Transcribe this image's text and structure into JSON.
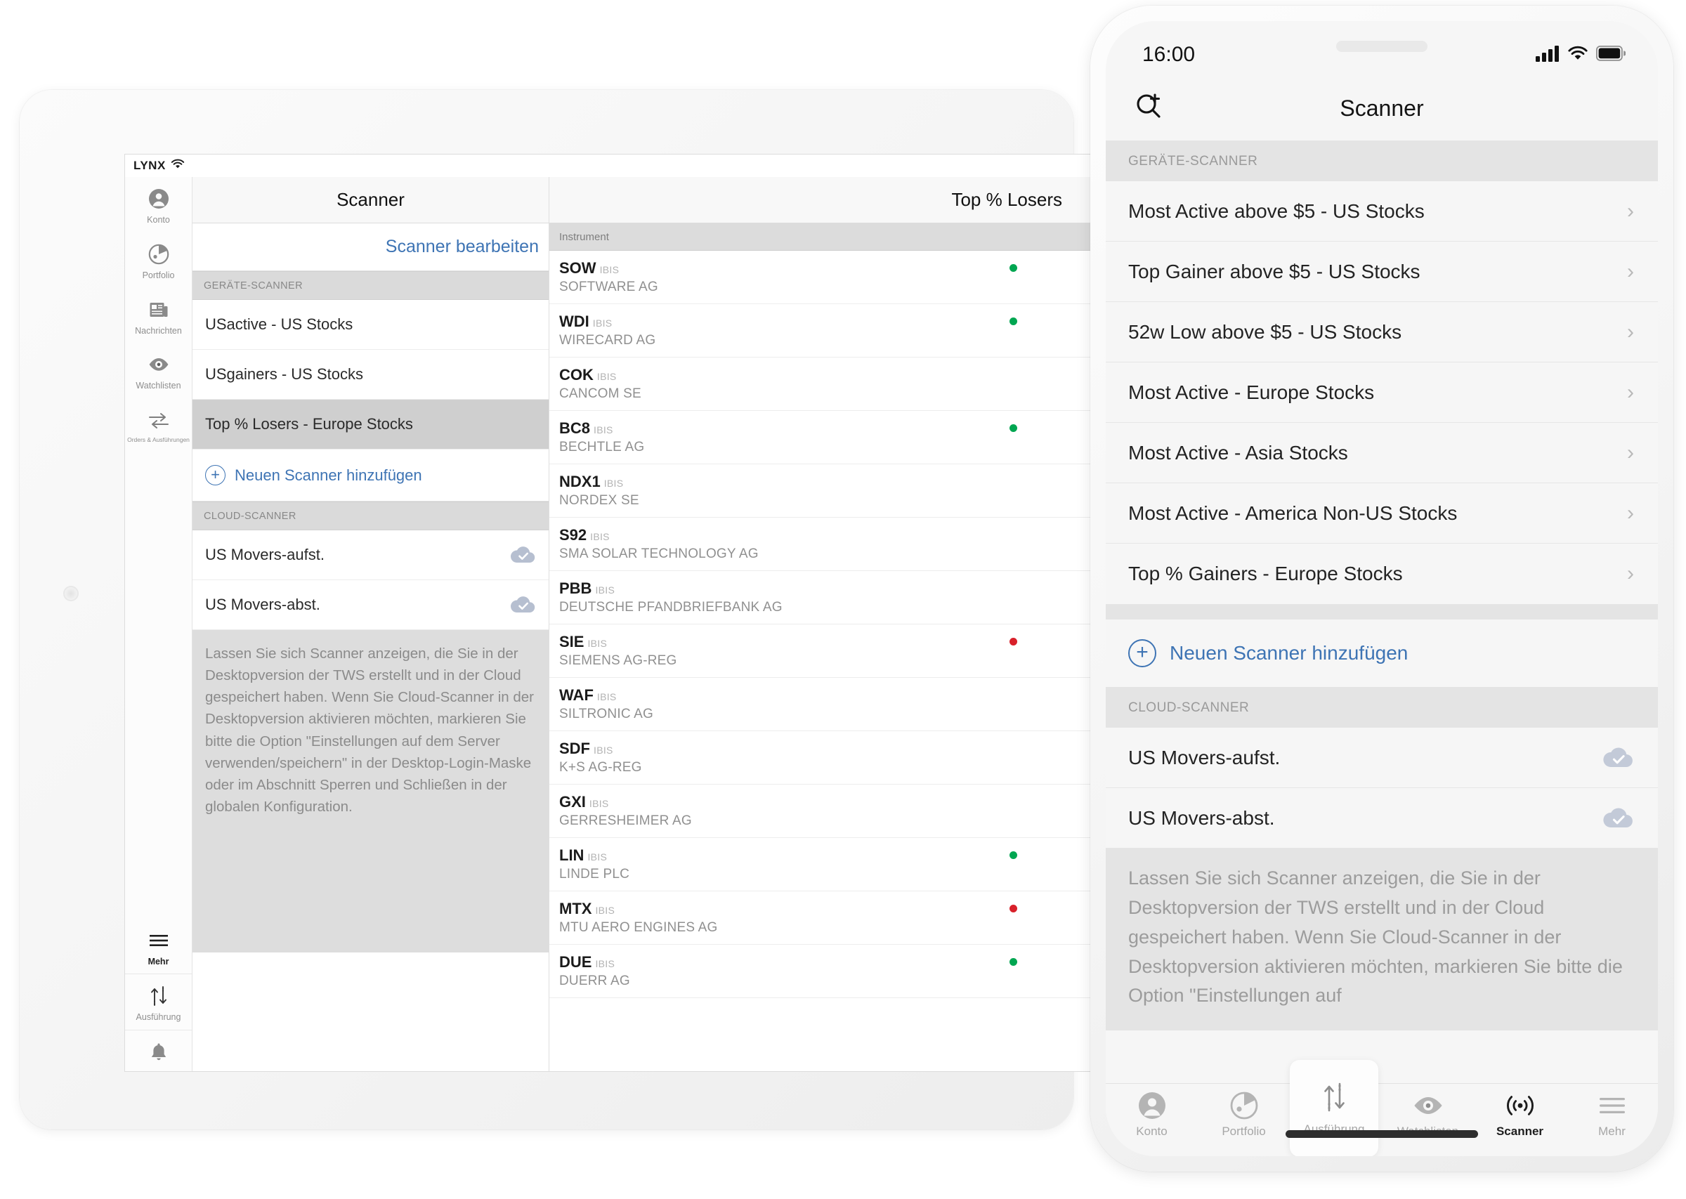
{
  "tablet": {
    "statusbar": {
      "brand": "LYNX",
      "wifi_icon": "wifi-icon"
    },
    "rail": [
      {
        "label": "Konto",
        "icon": "account-icon"
      },
      {
        "label": "Portfolio",
        "icon": "portfolio-pie-icon"
      },
      {
        "label": "Nachrichten",
        "icon": "news-icon"
      },
      {
        "label": "Watchlisten",
        "icon": "eye-icon"
      },
      {
        "label": "Orders & Ausführungen",
        "icon": "transfer-arrows-icon"
      },
      {
        "label": "Mehr",
        "icon": "hamburger-icon"
      },
      {
        "label": "Ausführung",
        "icon": "up-down-arrows-icon"
      },
      {
        "label": "",
        "icon": "bell-icon"
      }
    ],
    "left": {
      "title": "Scanner",
      "edit_link": "Scanner bearbeiten",
      "device_section": "GERÄTE-SCANNER",
      "device_items": [
        {
          "label": "USactive - US Stocks",
          "selected": false
        },
        {
          "label": "USgainers - US Stocks",
          "selected": false
        },
        {
          "label": "Top % Losers - Europe Stocks",
          "selected": true
        }
      ],
      "add_label": "Neuen Scanner hinzufügen",
      "cloud_section": "CLOUD-SCANNER",
      "cloud_items": [
        {
          "label": "US Movers-aufst.",
          "icon": "cloud-check-icon"
        },
        {
          "label": "US Movers-abst.",
          "icon": "cloud-check-icon"
        }
      ],
      "note": "Lassen Sie sich Scanner anzeigen, die Sie in der Desktopversion der TWS erstellt und in der Cloud gespeichert haben. Wenn Sie Cloud-Scanner in der Desktopversion aktivieren möchten, markieren Sie bitte die Option \"Einstellungen auf dem Server verwenden/speichern\" in der Desktop-Login-Maske oder im Abschnitt Sperren und Schließen in der globalen Konfiguration."
    },
    "right": {
      "title": "Top % Losers",
      "column_header": "Instrument",
      "rows": [
        {
          "symbol": "SOW",
          "exchange": "IBIS",
          "name": "SOFTWARE AG",
          "dot": "green"
        },
        {
          "symbol": "WDI",
          "exchange": "IBIS",
          "name": "WIRECARD AG",
          "dot": "green"
        },
        {
          "symbol": "COK",
          "exchange": "IBIS",
          "name": "CANCOM SE",
          "dot": "none"
        },
        {
          "symbol": "BC8",
          "exchange": "IBIS",
          "name": "BECHTLE AG",
          "dot": "green"
        },
        {
          "symbol": "NDX1",
          "exchange": "IBIS",
          "name": "NORDEX SE",
          "dot": "none"
        },
        {
          "symbol": "S92",
          "exchange": "IBIS",
          "name": "SMA SOLAR TECHNOLOGY AG",
          "dot": "none"
        },
        {
          "symbol": "PBB",
          "exchange": "IBIS",
          "name": "DEUTSCHE PFANDBRIEFBANK AG",
          "dot": "none"
        },
        {
          "symbol": "SIE",
          "exchange": "IBIS",
          "name": "SIEMENS AG-REG",
          "dot": "red"
        },
        {
          "symbol": "WAF",
          "exchange": "IBIS",
          "name": "SILTRONIC AG",
          "dot": "none"
        },
        {
          "symbol": "SDF",
          "exchange": "IBIS",
          "name": "K+S AG-REG",
          "dot": "none"
        },
        {
          "symbol": "GXI",
          "exchange": "IBIS",
          "name": "GERRESHEIMER AG",
          "dot": "none"
        },
        {
          "symbol": "LIN",
          "exchange": "IBIS",
          "name": "LINDE PLC",
          "dot": "green"
        },
        {
          "symbol": "MTX",
          "exchange": "IBIS",
          "name": "MTU AERO ENGINES AG",
          "dot": "red"
        },
        {
          "symbol": "DUE",
          "exchange": "IBIS",
          "name": "DUERR AG",
          "dot": "green"
        }
      ]
    }
  },
  "phone": {
    "statusbar": {
      "time": "16:00",
      "signal_icon": "cellular-signal-icon",
      "wifi_icon": "wifi-icon",
      "battery_icon": "battery-full-icon"
    },
    "navbar": {
      "title": "Scanner",
      "left_icon": "search-add-icon"
    },
    "device_section": "GERÄTE-SCANNER",
    "device_items": [
      {
        "label": "Most Active above $5 - US Stocks",
        "chevron": "chevron-right-icon"
      },
      {
        "label": "Top Gainer above $5 - US Stocks",
        "chevron": "chevron-right-icon"
      },
      {
        "label": "52w Low above $5 - US Stocks",
        "chevron": "chevron-right-icon"
      },
      {
        "label": "Most Active - Europe Stocks",
        "chevron": "chevron-right-icon"
      },
      {
        "label": "Most Active - Asia Stocks",
        "chevron": "chevron-right-icon"
      },
      {
        "label": "Most Active - America Non-US Stocks",
        "chevron": "chevron-right-icon"
      },
      {
        "label": "Top % Gainers - Europe Stocks",
        "chevron": "chevron-right-icon"
      }
    ],
    "add_label": "Neuen Scanner hinzufügen",
    "cloud_section": "CLOUD-SCANNER",
    "cloud_items": [
      {
        "label": "US Movers-aufst.",
        "icon": "cloud-check-icon"
      },
      {
        "label": "US Movers-abst.",
        "icon": "cloud-check-icon"
      }
    ],
    "note": "Lassen Sie sich Scanner anzeigen, die Sie in der Desktopversion der TWS erstellt und in der Cloud gespeichert haben. Wenn Sie Cloud-Scanner in der Desktopversion aktivieren möchten, markieren Sie bitte die Option \"Einstellungen auf",
    "tabs": [
      {
        "label": "Konto",
        "icon": "account-icon",
        "active": false
      },
      {
        "label": "Portfolio",
        "icon": "portfolio-pie-icon",
        "active": false
      },
      {
        "label": "Ausführung",
        "icon": "up-down-arrows-icon",
        "active": false
      },
      {
        "label": "Watchlisten",
        "icon": "eye-icon",
        "active": false
      },
      {
        "label": "Scanner",
        "icon": "radar-waves-icon",
        "active": true
      },
      {
        "label": "Mehr",
        "icon": "hamburger-icon",
        "active": false
      }
    ]
  },
  "colors": {
    "accent_blue": "#3e74b4",
    "up_green": "#00a651",
    "down_red": "#d8202a",
    "section_gray": "#dadada",
    "selected_gray": "#cfcfcf"
  }
}
